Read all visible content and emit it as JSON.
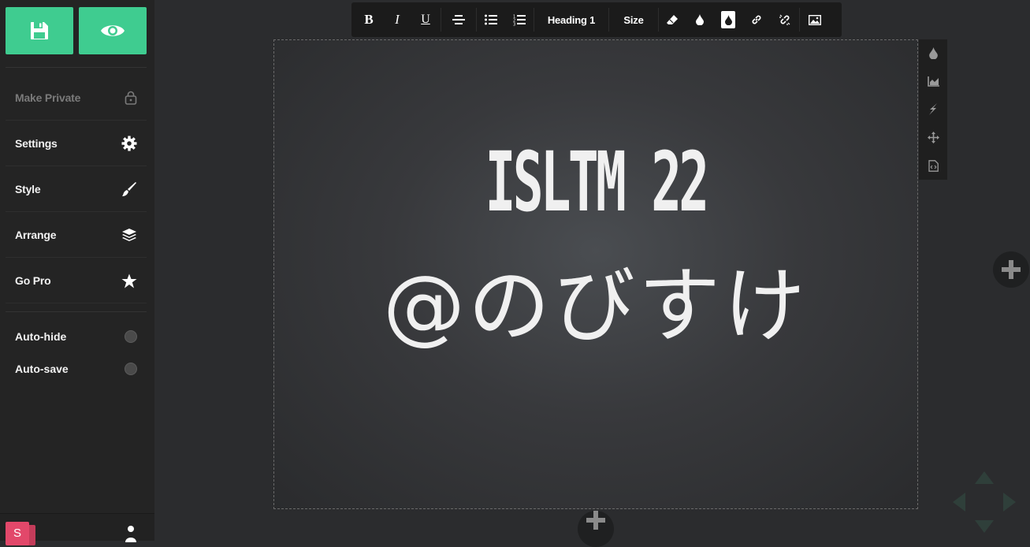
{
  "sidebar": {
    "top_buttons": [
      {
        "icon": "save-icon"
      },
      {
        "icon": "eye-icon"
      }
    ],
    "menu": [
      {
        "label": "Make Private",
        "icon": "lock-icon",
        "disabled": true
      },
      {
        "label": "Settings",
        "icon": "gear-icon"
      },
      {
        "label": "Style",
        "icon": "brush-icon"
      },
      {
        "label": "Arrange",
        "icon": "layers-icon"
      },
      {
        "label": "Go Pro",
        "icon": "star-icon"
      }
    ],
    "toggles": [
      {
        "label": "Auto-hide",
        "on": false
      },
      {
        "label": "Auto-save",
        "on": false
      }
    ],
    "footer": {
      "logo_letter": "S",
      "icon": "user-icon"
    }
  },
  "toolbar": {
    "bold": "B",
    "italic": "I",
    "underline": "U",
    "heading": "Heading 1",
    "size": "Size"
  },
  "slide": {
    "title": "ISLTM 22",
    "subtitle": "@のびすけ"
  },
  "colors": {
    "accent": "#3fcc90",
    "sidebar_bg": "#242424",
    "toolbar_bg": "#1b1b1b",
    "canvas_bg": "#2b2c2e"
  }
}
